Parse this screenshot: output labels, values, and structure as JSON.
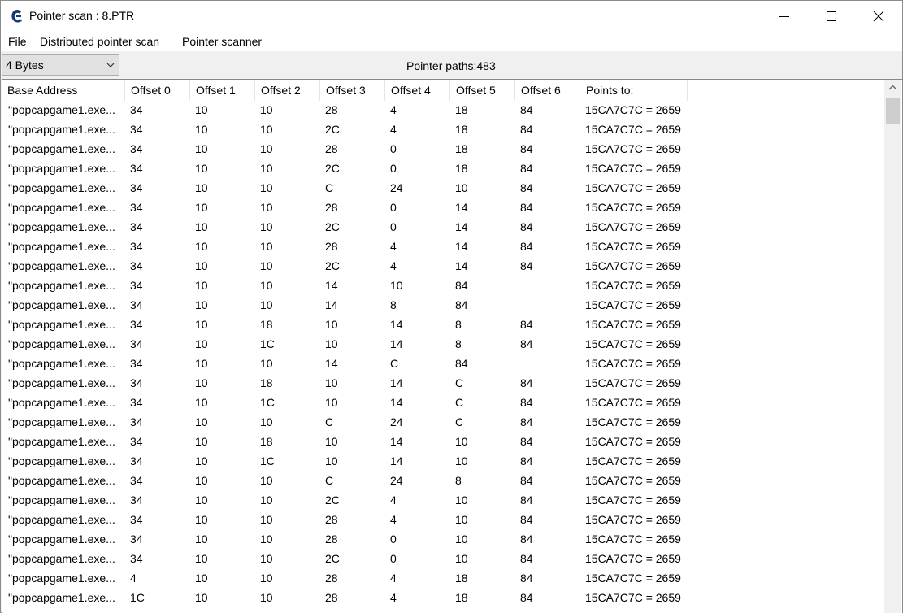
{
  "window": {
    "title": "Pointer scan : 8.PTR",
    "icon": "cheat-engine-icon"
  },
  "menu": {
    "file": "File",
    "distributed": "Distributed pointer scan",
    "scanner": "Pointer scanner"
  },
  "toolbar": {
    "value_type": "4 Bytes",
    "pointer_paths": "Pointer paths:483"
  },
  "table": {
    "columns": [
      "Base Address",
      "Offset 0",
      "Offset 1",
      "Offset 2",
      "Offset 3",
      "Offset 4",
      "Offset 5",
      "Offset 6",
      "Points to:"
    ],
    "rows": [
      [
        "\"popcapgame1.exe...",
        "34",
        "10",
        "10",
        "28",
        "4",
        "18",
        "84",
        "15CA7C7C = 2659"
      ],
      [
        "\"popcapgame1.exe...",
        "34",
        "10",
        "10",
        "2C",
        "4",
        "18",
        "84",
        "15CA7C7C = 2659"
      ],
      [
        "\"popcapgame1.exe...",
        "34",
        "10",
        "10",
        "28",
        "0",
        "18",
        "84",
        "15CA7C7C = 2659"
      ],
      [
        "\"popcapgame1.exe...",
        "34",
        "10",
        "10",
        "2C",
        "0",
        "18",
        "84",
        "15CA7C7C = 2659"
      ],
      [
        "\"popcapgame1.exe...",
        "34",
        "10",
        "10",
        "C",
        "24",
        "10",
        "84",
        "15CA7C7C = 2659"
      ],
      [
        "\"popcapgame1.exe...",
        "34",
        "10",
        "10",
        "28",
        "0",
        "14",
        "84",
        "15CA7C7C = 2659"
      ],
      [
        "\"popcapgame1.exe...",
        "34",
        "10",
        "10",
        "2C",
        "0",
        "14",
        "84",
        "15CA7C7C = 2659"
      ],
      [
        "\"popcapgame1.exe...",
        "34",
        "10",
        "10",
        "28",
        "4",
        "14",
        "84",
        "15CA7C7C = 2659"
      ],
      [
        "\"popcapgame1.exe...",
        "34",
        "10",
        "10",
        "2C",
        "4",
        "14",
        "84",
        "15CA7C7C = 2659"
      ],
      [
        "\"popcapgame1.exe...",
        "34",
        "10",
        "10",
        "14",
        "10",
        "84",
        "",
        "15CA7C7C = 2659"
      ],
      [
        "\"popcapgame1.exe...",
        "34",
        "10",
        "10",
        "14",
        "8",
        "84",
        "",
        "15CA7C7C = 2659"
      ],
      [
        "\"popcapgame1.exe...",
        "34",
        "10",
        "18",
        "10",
        "14",
        "8",
        "84",
        "15CA7C7C = 2659"
      ],
      [
        "\"popcapgame1.exe...",
        "34",
        "10",
        "1C",
        "10",
        "14",
        "8",
        "84",
        "15CA7C7C = 2659"
      ],
      [
        "\"popcapgame1.exe...",
        "34",
        "10",
        "10",
        "14",
        "C",
        "84",
        "",
        "15CA7C7C = 2659"
      ],
      [
        "\"popcapgame1.exe...",
        "34",
        "10",
        "18",
        "10",
        "14",
        "C",
        "84",
        "15CA7C7C = 2659"
      ],
      [
        "\"popcapgame1.exe...",
        "34",
        "10",
        "1C",
        "10",
        "14",
        "C",
        "84",
        "15CA7C7C = 2659"
      ],
      [
        "\"popcapgame1.exe...",
        "34",
        "10",
        "10",
        "C",
        "24",
        "C",
        "84",
        "15CA7C7C = 2659"
      ],
      [
        "\"popcapgame1.exe...",
        "34",
        "10",
        "18",
        "10",
        "14",
        "10",
        "84",
        "15CA7C7C = 2659"
      ],
      [
        "\"popcapgame1.exe...",
        "34",
        "10",
        "1C",
        "10",
        "14",
        "10",
        "84",
        "15CA7C7C = 2659"
      ],
      [
        "\"popcapgame1.exe...",
        "34",
        "10",
        "10",
        "C",
        "24",
        "8",
        "84",
        "15CA7C7C = 2659"
      ],
      [
        "\"popcapgame1.exe...",
        "34",
        "10",
        "10",
        "2C",
        "4",
        "10",
        "84",
        "15CA7C7C = 2659"
      ],
      [
        "\"popcapgame1.exe...",
        "34",
        "10",
        "10",
        "28",
        "4",
        "10",
        "84",
        "15CA7C7C = 2659"
      ],
      [
        "\"popcapgame1.exe...",
        "34",
        "10",
        "10",
        "28",
        "0",
        "10",
        "84",
        "15CA7C7C = 2659"
      ],
      [
        "\"popcapgame1.exe...",
        "34",
        "10",
        "10",
        "2C",
        "0",
        "10",
        "84",
        "15CA7C7C = 2659"
      ],
      [
        "\"popcapgame1.exe...",
        "4",
        "10",
        "10",
        "28",
        "4",
        "18",
        "84",
        "15CA7C7C = 2659"
      ],
      [
        "\"popcapgame1.exe...",
        "1C",
        "10",
        "10",
        "28",
        "4",
        "18",
        "84",
        "15CA7C7C = 2659"
      ]
    ]
  }
}
